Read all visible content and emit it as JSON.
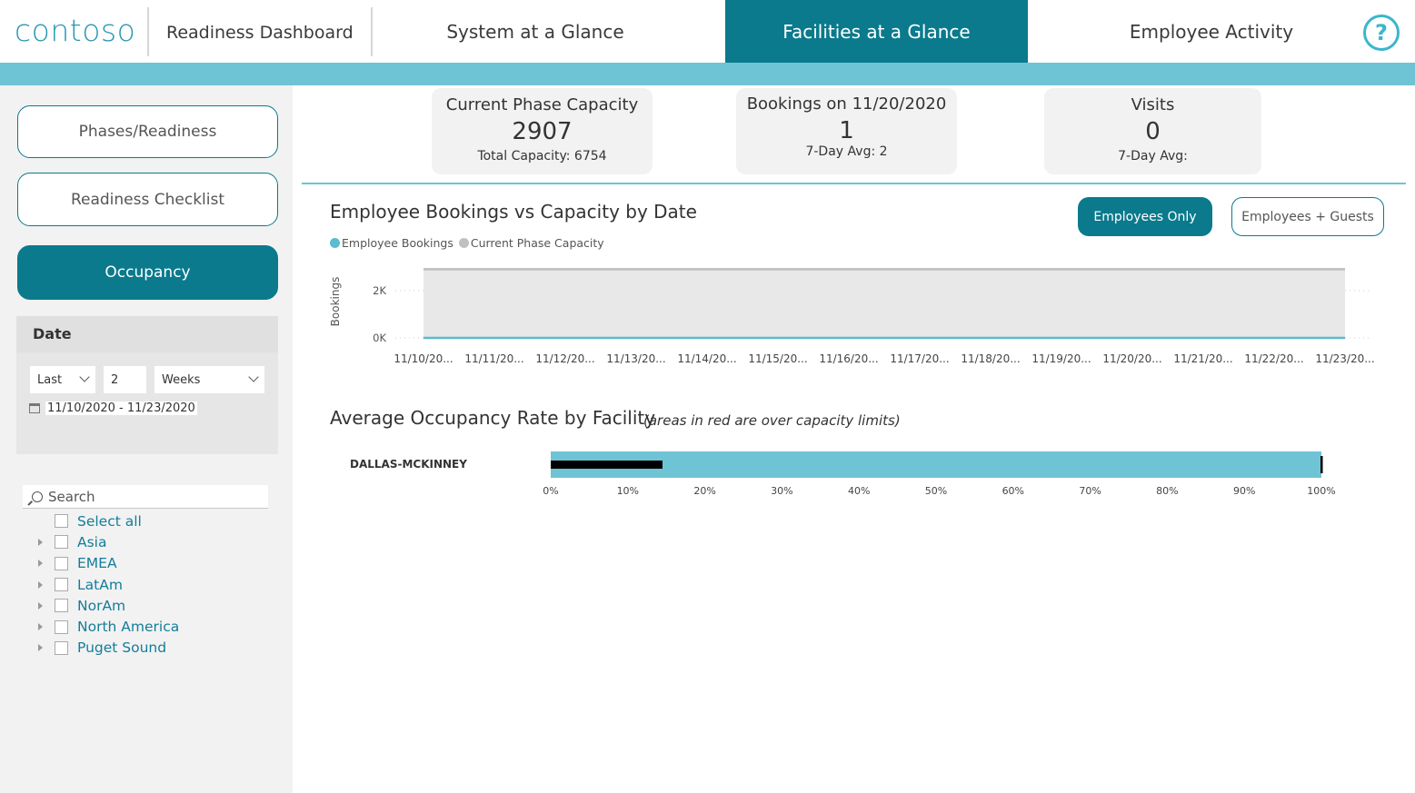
{
  "header": {
    "logo": "contoso",
    "app_title": "Readiness Dashboard",
    "tabs": [
      {
        "label": "System at a Glance",
        "active": false
      },
      {
        "label": "Facilities at a Glance",
        "active": true
      },
      {
        "label": "Employee Activity",
        "active": false
      }
    ],
    "help_glyph": "?"
  },
  "sidebar": {
    "buttons": [
      {
        "label": "Phases/Readiness",
        "active": false
      },
      {
        "label": "Readiness Checklist",
        "active": false
      },
      {
        "label": "Occupancy",
        "active": true
      }
    ],
    "date_filter": {
      "title": "Date",
      "period_mode": "Last",
      "period_count": "2",
      "period_unit": "Weeks",
      "range": "11/10/2020 - 11/23/2020"
    },
    "search_placeholder": "Search",
    "tree_items": [
      "Select all",
      "Asia",
      "EMEA",
      "LatAm",
      "NorAm",
      "North America",
      "Puget Sound"
    ]
  },
  "kpis": [
    {
      "title": "Current Phase Capacity",
      "value": "2907",
      "sub": "Total Capacity: 6754"
    },
    {
      "title": "Bookings on 11/20/2020",
      "value": "1",
      "sub": "7-Day Avg: 2"
    },
    {
      "title": "Visits",
      "value": "0",
      "sub": "7-Day Avg:"
    }
  ],
  "bookings_chart": {
    "title": "Employee Bookings vs Capacity by Date",
    "toggles": {
      "employees_only": "Employees Only",
      "employees_guests": "Employees + Guests"
    },
    "chart_data": {
      "type": "area",
      "x": [
        "11/10/20...",
        "11/11/20...",
        "11/12/20...",
        "11/13/20...",
        "11/14/20...",
        "11/15/20...",
        "11/16/20...",
        "11/17/20...",
        "11/18/20...",
        "11/19/20...",
        "11/20/20...",
        "11/21/20...",
        "11/22/20...",
        "11/23/20..."
      ],
      "series": [
        {
          "name": "Employee Bookings",
          "color": "#5bbcd0",
          "values": [
            2,
            2,
            2,
            2,
            2,
            2,
            2,
            2,
            2,
            2,
            1,
            2,
            2,
            2
          ]
        },
        {
          "name": "Current Phase Capacity",
          "color": "#c0c0c0",
          "values": [
            2907,
            2907,
            2907,
            2907,
            2907,
            2907,
            2907,
            2907,
            2907,
            2907,
            2907,
            2907,
            2907,
            2907
          ]
        }
      ],
      "ylabel": "Bookings",
      "yticks": [
        "2K",
        "0K"
      ],
      "ylim": [
        0,
        3000
      ],
      "grid": true,
      "legend": "top-left"
    }
  },
  "occupancy_chart": {
    "title": "Average Occupancy Rate by Facility",
    "note": "(areas in red are over capacity limits)",
    "chart_data": {
      "type": "bar",
      "orientation": "horizontal",
      "categories": [
        "DALLAS-MCKINNEY"
      ],
      "series": [
        {
          "color": "#6ec4d4",
          "values": [
            1.0
          ]
        },
        {
          "color": "#000000",
          "values": [
            0.145
          ]
        }
      ],
      "xticks": [
        "0%",
        "10%",
        "20%",
        "30%",
        "40%",
        "50%",
        "60%",
        "70%",
        "80%",
        "90%",
        "100%"
      ],
      "xlim": [
        0,
        1
      ]
    }
  }
}
